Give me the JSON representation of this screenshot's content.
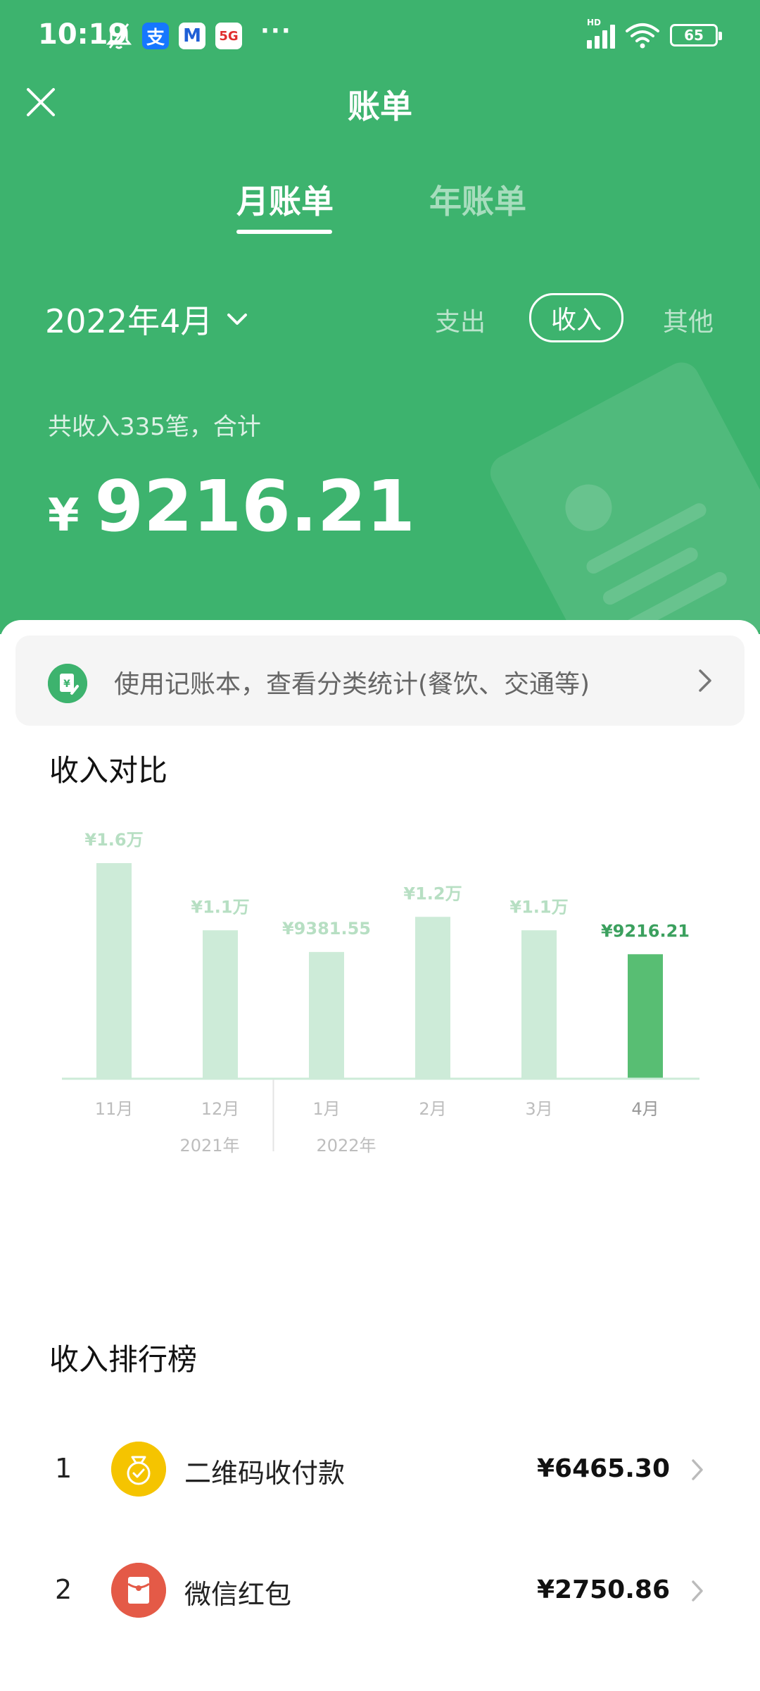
{
  "status_bar": {
    "time": "10:19",
    "app_badges": [
      "支",
      "M",
      "5G"
    ],
    "more": "···",
    "signal_label": "HD",
    "battery": "65",
    "icons": [
      "mute-bell-icon",
      "alipay-icon",
      "app-m-icon",
      "5g-icon",
      "signal-icon",
      "wifi-icon",
      "battery-icon"
    ]
  },
  "nav": {
    "title": "账单",
    "close_icon": "close-icon"
  },
  "tabs": {
    "month": "月账单",
    "year": "年账单",
    "active": "month"
  },
  "month_picker": {
    "value": "2022年4月"
  },
  "filters": {
    "expense": "支出",
    "income": "收入",
    "other": "其他",
    "active": "income"
  },
  "summary": {
    "label": "共收入335笔，合计",
    "currency": "¥",
    "amount": "9216.21"
  },
  "promo": {
    "text": "使用记账本，查看分类统计(餐饮、交通等)"
  },
  "sections": {
    "compare_title": "收入对比",
    "ranking_title": "收入排行榜"
  },
  "chart_data": {
    "type": "bar",
    "categories": [
      "11月",
      "12月",
      "1月",
      "2月",
      "3月",
      "4月"
    ],
    "values": [
      16000,
      11000,
      9381.55,
      12000,
      11000,
      9216.21
    ],
    "data_labels": [
      "¥1.6万",
      "¥1.1万",
      "¥9381.55",
      "¥1.2万",
      "¥1.1万",
      "¥9216.21"
    ],
    "year_labels": [
      "2021年",
      "2022年"
    ],
    "highlight_index": 5,
    "colors": {
      "bar": "#cdebd8",
      "highlight": "#58be73",
      "label": "#b7dfc3",
      "highlight_label": "#3ba05e",
      "axis": "#cdebd8",
      "tick": "#bdbdbd"
    },
    "ylim": [
      0,
      16000
    ]
  },
  "ranking": [
    {
      "rank": "1",
      "name": "二维码收付款",
      "amount": "¥6465.30",
      "icon": "qr-payment-bag-icon",
      "color": "#f5c400"
    },
    {
      "rank": "2",
      "name": "微信红包",
      "amount": "¥2750.86",
      "icon": "red-packet-icon",
      "color": "#e45a47"
    }
  ],
  "colors": {
    "brand": "#3db36e"
  }
}
